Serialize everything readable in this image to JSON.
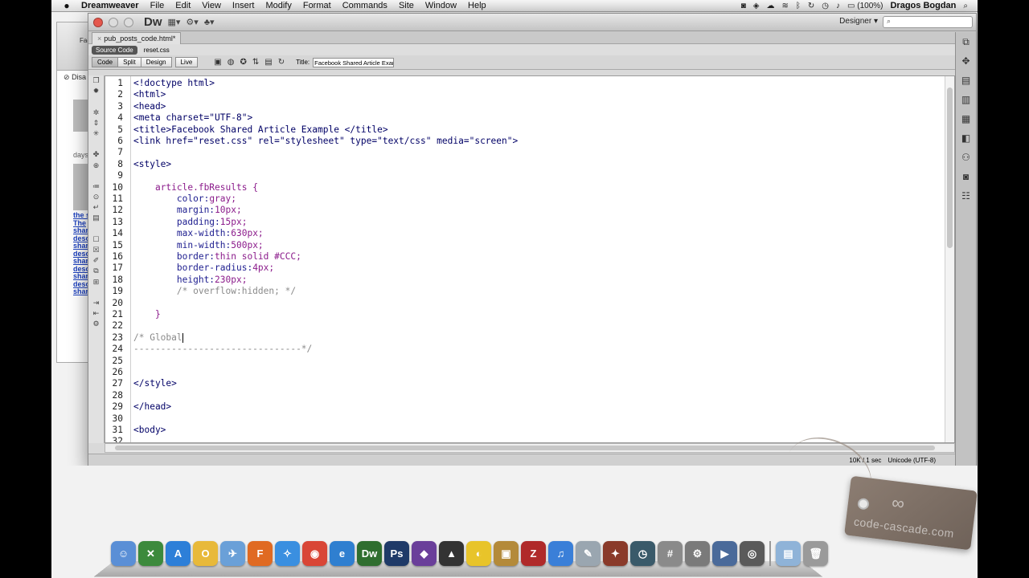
{
  "menubar": {
    "app_name": "Dreamweaver",
    "items": [
      "File",
      "Edit",
      "View",
      "Insert",
      "Modify",
      "Format",
      "Commands",
      "Site",
      "Window",
      "Help"
    ],
    "battery": "(100%)",
    "user": "Dragos Bogdan"
  },
  "bg_window": {
    "tab": "Fac",
    "disabled": "Disa",
    "days": "days",
    "links": [
      "the s",
      "The",
      "shar",
      "desc",
      "shar",
      "desc",
      "shar",
      "desc",
      "shar",
      "desc",
      "shar"
    ]
  },
  "window": {
    "logo": "Dw",
    "workspace": "Designer",
    "doc_tab": "pub_posts_code.html*",
    "related": {
      "source_code": "Source Code",
      "files": [
        "reset.css"
      ]
    },
    "toolbar": {
      "views": [
        "Code",
        "Split",
        "Design",
        "Live"
      ],
      "active_view": "Code",
      "title_label": "Title:",
      "title_value": "Facebook Shared Article Exam"
    },
    "status": {
      "size": "10K / 1 sec",
      "encoding": "Unicode (UTF-8)"
    }
  },
  "code_lines": [
    {
      "n": "1",
      "segs": [
        [
          "tag",
          "<!doctype html>"
        ]
      ]
    },
    {
      "n": "2",
      "segs": [
        [
          "tag",
          "<html>"
        ]
      ]
    },
    {
      "n": "3",
      "segs": [
        [
          "tag",
          "<head>"
        ]
      ]
    },
    {
      "n": "4",
      "segs": [
        [
          "tag",
          "<meta charset=\"UTF-8\">"
        ]
      ]
    },
    {
      "n": "5",
      "segs": [
        [
          "tag",
          "<title>Facebook Shared Article Example </title>"
        ]
      ]
    },
    {
      "n": "6",
      "segs": [
        [
          "tag",
          "<link href=\"reset.css\" rel=\"stylesheet\" type=\"text/css\" media=\"screen\">"
        ]
      ]
    },
    {
      "n": "7",
      "segs": []
    },
    {
      "n": "8",
      "segs": [
        [
          "tag",
          "<style>"
        ]
      ]
    },
    {
      "n": "9",
      "segs": []
    },
    {
      "n": "10",
      "segs": [
        [
          "plain",
          "    "
        ],
        [
          "sel",
          "article.fbResults {"
        ]
      ]
    },
    {
      "n": "11",
      "segs": [
        [
          "plain",
          "        "
        ],
        [
          "prop",
          "color:"
        ],
        [
          "val",
          "gray;"
        ]
      ]
    },
    {
      "n": "12",
      "segs": [
        [
          "plain",
          "        "
        ],
        [
          "prop",
          "margin:"
        ],
        [
          "val",
          "10px;"
        ]
      ]
    },
    {
      "n": "13",
      "segs": [
        [
          "plain",
          "        "
        ],
        [
          "prop",
          "padding:"
        ],
        [
          "val",
          "15px;"
        ]
      ]
    },
    {
      "n": "14",
      "segs": [
        [
          "plain",
          "        "
        ],
        [
          "prop",
          "max-width:"
        ],
        [
          "val",
          "630px;"
        ]
      ]
    },
    {
      "n": "15",
      "segs": [
        [
          "plain",
          "        "
        ],
        [
          "prop",
          "min-width:"
        ],
        [
          "val",
          "500px;"
        ]
      ]
    },
    {
      "n": "16",
      "segs": [
        [
          "plain",
          "        "
        ],
        [
          "prop",
          "border:"
        ],
        [
          "val",
          "thin solid #CCC;"
        ]
      ]
    },
    {
      "n": "17",
      "segs": [
        [
          "plain",
          "        "
        ],
        [
          "prop",
          "border-radius:"
        ],
        [
          "val",
          "4px;"
        ]
      ]
    },
    {
      "n": "18",
      "segs": [
        [
          "plain",
          "        "
        ],
        [
          "prop",
          "height:"
        ],
        [
          "val",
          "230px;"
        ]
      ]
    },
    {
      "n": "19",
      "segs": [
        [
          "plain",
          "        "
        ],
        [
          "cmt",
          "/* overflow:hidden; */"
        ]
      ]
    },
    {
      "n": "20",
      "segs": []
    },
    {
      "n": "21",
      "segs": [
        [
          "plain",
          "    "
        ],
        [
          "sel",
          "}"
        ]
      ]
    },
    {
      "n": "22",
      "segs": []
    },
    {
      "n": "23",
      "segs": [
        [
          "cmt",
          "/* Global"
        ]
      ],
      "caret": true
    },
    {
      "n": "24",
      "segs": [
        [
          "cmt",
          "-------------------------------*/"
        ]
      ]
    },
    {
      "n": "25",
      "segs": []
    },
    {
      "n": "26",
      "segs": []
    },
    {
      "n": "27",
      "segs": [
        [
          "tag",
          "</style>"
        ]
      ]
    },
    {
      "n": "28",
      "segs": []
    },
    {
      "n": "29",
      "segs": [
        [
          "tag",
          "</head>"
        ]
      ]
    },
    {
      "n": "30",
      "segs": []
    },
    {
      "n": "31",
      "segs": [
        [
          "tag",
          "<body>"
        ]
      ]
    },
    {
      "n": "32",
      "segs": []
    }
  ],
  "tag_card": {
    "brand": "code-cascade.com"
  },
  "dock": [
    {
      "name": "finder",
      "glyph": "☺",
      "color": "#5a8fd6"
    },
    {
      "name": "keepassx",
      "glyph": "✕",
      "color": "#3c8a3c"
    },
    {
      "name": "app-store",
      "glyph": "A",
      "color": "#2d7fd8"
    },
    {
      "name": "onebutton",
      "glyph": "O",
      "color": "#e8b93a"
    },
    {
      "name": "mail",
      "glyph": "✈",
      "color": "#6aa0d8"
    },
    {
      "name": "firefox",
      "glyph": "F",
      "color": "#e06a22"
    },
    {
      "name": "safari",
      "glyph": "✧",
      "color": "#3a8fe0"
    },
    {
      "name": "chrome",
      "glyph": "◉",
      "color": "#d94636"
    },
    {
      "name": "ie",
      "glyph": "e",
      "color": "#2f7fd0"
    },
    {
      "name": "dreamweaver",
      "glyph": "Dw",
      "color": "#2f6e2f"
    },
    {
      "name": "photoshop",
      "glyph": "Ps",
      "color": "#1f3a68"
    },
    {
      "name": "visual-studio",
      "glyph": "◆",
      "color": "#6a3f9a"
    },
    {
      "name": "inkscape",
      "glyph": "▲",
      "color": "#333333"
    },
    {
      "name": "cyberduck",
      "glyph": "◐",
      "color": "#e8c42a"
    },
    {
      "name": "transmit",
      "glyph": "▣",
      "color": "#b48a3a"
    },
    {
      "name": "filezilla",
      "glyph": "Z",
      "color": "#b02a2a"
    },
    {
      "name": "itunes",
      "glyph": "♫",
      "color": "#3a7fd8"
    },
    {
      "name": "preview",
      "glyph": "✎",
      "color": "#9aa6b0"
    },
    {
      "name": "photo-booth",
      "glyph": "✦",
      "color": "#8a3a2a"
    },
    {
      "name": "time-machine",
      "glyph": "◷",
      "color": "#3a5a6a"
    },
    {
      "name": "calculator",
      "glyph": "#",
      "color": "#8a8a8a"
    },
    {
      "name": "system-preferences",
      "glyph": "⚙",
      "color": "#7a7a7a"
    },
    {
      "name": "screen-recorder",
      "glyph": "▶",
      "color": "#4a6a9a"
    },
    {
      "name": "image-capture",
      "glyph": "◎",
      "color": "#5a5a5a"
    },
    {
      "name": "sep",
      "glyph": "",
      "color": ""
    },
    {
      "name": "documents-folder",
      "glyph": "▤",
      "color": "#8fb3d8"
    },
    {
      "name": "trash",
      "glyph": "🗑",
      "color": "#9a9a9a"
    }
  ]
}
